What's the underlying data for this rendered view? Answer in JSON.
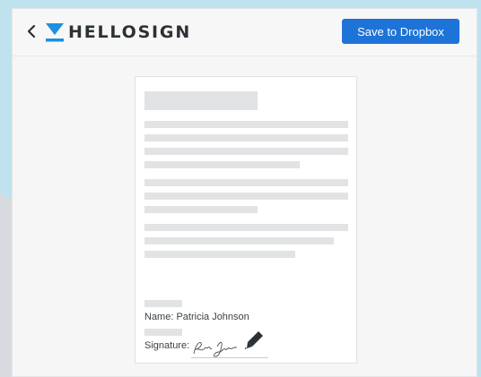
{
  "header": {
    "logo_text": "HELLOSIGN",
    "save_button_label": "Save to Dropbox",
    "icons": {
      "back": "chevron-left-icon",
      "logo": "hellosign-logo-mark"
    }
  },
  "document": {
    "name_label": "Name: Patricia Johnson",
    "signature_label": "Signature:",
    "signature_icon": "pen-icon"
  },
  "colors": {
    "accent": "#1e73d8",
    "logo_blue": "#1e8fe0",
    "background_blue": "#bfe3ee",
    "placeholder_bar": "#e2e3e5",
    "text_dark": "#2b3135"
  }
}
